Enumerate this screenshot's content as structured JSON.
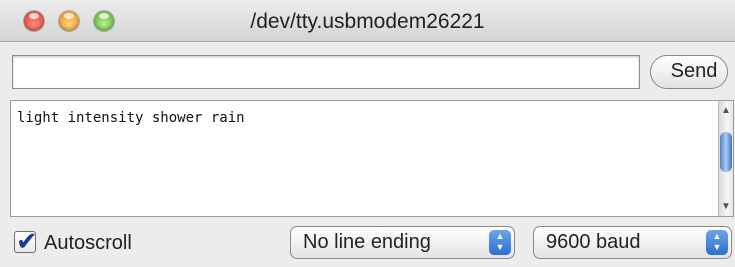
{
  "window": {
    "title": "/dev/tty.usbmodem26221"
  },
  "send": {
    "input_value": "",
    "button_label": "Send"
  },
  "output": {
    "text": "light intensity shower rain"
  },
  "footer": {
    "autoscroll_label": "Autoscroll",
    "autoscroll_checked": true,
    "line_ending_value": "No line ending",
    "baud_value": "9600 baud"
  },
  "colors": {
    "close_light": "#e0463a",
    "minimize_light": "#f0a032",
    "maximize_light": "#6cbf45",
    "scroll_thumb": "#5b8ed6"
  },
  "icons": {
    "checkbox": "checkmark",
    "select_stepper": "up-down-arrows"
  }
}
